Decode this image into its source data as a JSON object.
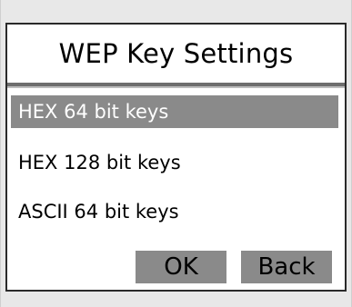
{
  "dialog": {
    "title": "WEP Key Settings",
    "options": [
      {
        "label": "HEX 64 bit keys",
        "selected": true
      },
      {
        "label": "HEX 128 bit keys",
        "selected": false
      },
      {
        "label": "ASCII 64 bit keys",
        "selected": false
      }
    ],
    "buttons": {
      "ok": "OK",
      "back": "Back"
    }
  },
  "colors": {
    "background": "#e8e8e8",
    "panel": "#ffffff",
    "border": "#2a2a2a",
    "selection": "#8a8a8a",
    "selected_text": "#ffffff",
    "button": "#8a8a8a"
  }
}
